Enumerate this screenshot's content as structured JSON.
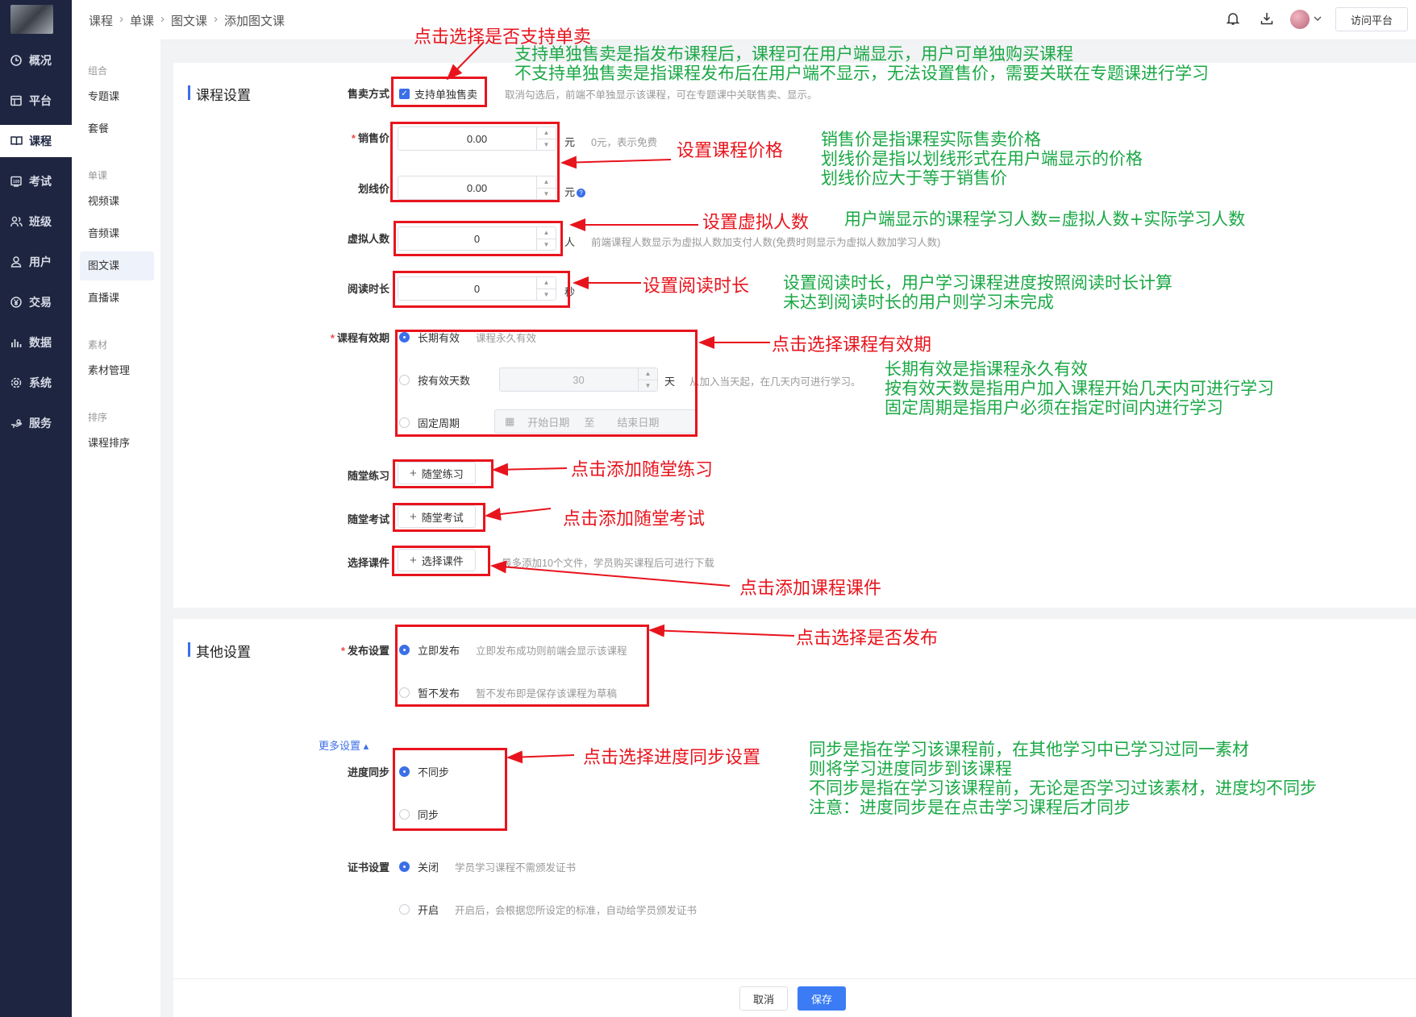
{
  "sidebar": {
    "items": [
      {
        "label": "概况",
        "icon": "clock-icon"
      },
      {
        "label": "平台",
        "icon": "browser-icon"
      },
      {
        "label": "课程",
        "icon": "book-icon"
      },
      {
        "label": "考试",
        "icon": "exam-icon"
      },
      {
        "label": "班级",
        "icon": "group-icon"
      },
      {
        "label": "用户",
        "icon": "user-icon"
      },
      {
        "label": "交易",
        "icon": "yuan-icon"
      },
      {
        "label": "数据",
        "icon": "bar-chart-icon"
      },
      {
        "label": "系统",
        "icon": "gear-icon"
      },
      {
        "label": "服务",
        "icon": "hand-icon"
      }
    ]
  },
  "submenu": {
    "groups": [
      "组合",
      "单课",
      "素材",
      "排序"
    ],
    "items": [
      "专题课",
      "套餐",
      "视频课",
      "音频课",
      "图文课",
      "直播课",
      "素材管理",
      "课程排序"
    ]
  },
  "topbar": {
    "breadcrumb": [
      "课程",
      "单课",
      "图文课",
      "添加图文课"
    ],
    "visit_label": "访问平台"
  },
  "course_settings": {
    "title": "课程设置",
    "sale_mode": {
      "label": "售卖方式",
      "checkbox": "支持单独售卖",
      "hint": "取消勾选后，前端不单独显示该课程，可在专题课中关联售卖、显示。"
    },
    "price": {
      "label": "销售价",
      "value": "0.00",
      "unit": "元",
      "hint": "0元，表示免费"
    },
    "strike_price": {
      "label": "划线价",
      "value": "0.00",
      "unit": "元"
    },
    "virtual_count": {
      "label": "虚拟人数",
      "value": "0",
      "unit": "人",
      "hint": "前端课程人数显示为虚拟人数加支付人数(免费时则显示为虚拟人数加学习人数)"
    },
    "read_time": {
      "label": "阅读时长",
      "value": "0",
      "unit": "秒"
    },
    "validity": {
      "label": "课程有效期",
      "options": [
        {
          "label": "长期有效",
          "hint": "课程永久有效",
          "selected": true
        },
        {
          "label": "按有效天数",
          "selected": false
        },
        {
          "label": "固定周期",
          "selected": false
        }
      ],
      "days_value": "30",
      "days_unit": "天",
      "days_hint": "从加入当天起，在几天内可进行学习。",
      "start_placeholder": "开始日期",
      "range_sep": "至",
      "end_placeholder": "结束日期"
    },
    "practice": {
      "label": "随堂练习",
      "button": "随堂练习"
    },
    "exam": {
      "label": "随堂考试",
      "button": "随堂考试"
    },
    "courseware": {
      "label": "选择课件",
      "button": "选择课件",
      "hint": "最多添加10个文件，学员购买课程后可进行下载"
    }
  },
  "other_settings": {
    "title": "其他设置",
    "publish": {
      "label": "发布设置",
      "options": [
        {
          "label": "立即发布",
          "hint": "立即发布成功则前端会显示该课程",
          "selected": true
        },
        {
          "label": "暂不发布",
          "hint": "暂不发布即是保存该课程为草稿",
          "selected": false
        }
      ]
    },
    "more_link": "更多设置 ▴",
    "sync": {
      "label": "进度同步",
      "options": [
        {
          "label": "不同步",
          "selected": true
        },
        {
          "label": "同步",
          "selected": false
        }
      ]
    },
    "certificate": {
      "label": "证书设置",
      "options": [
        {
          "label": "关闭",
          "hint": "学员学习课程不需颁发证书",
          "selected": true
        },
        {
          "label": "开启",
          "hint": "开启后，会根据您所设定的标准，自动给学员颁发证书",
          "selected": false
        }
      ]
    }
  },
  "footer": {
    "cancel": "取消",
    "save": "保存"
  },
  "annotations": {
    "sale_red": "点击选择是否支持单卖",
    "sale_green": [
      "支持单独售卖是指发布课程后，课程可在用户端显示，用户可单独购买课程",
      "不支持单独售卖是指课程发布后在用户端不显示，无法设置售价，需要关联在专题课进行学习"
    ],
    "price_red": "设置课程价格",
    "price_green": [
      "销售价是指课程实际售卖价格",
      "划线价是指以划线形式在用户端显示的价格",
      "划线价应大于等于销售价"
    ],
    "virtual_red": "设置虚拟人数",
    "virtual_green": "用户端显示的课程学习人数=虚拟人数+实际学习人数",
    "read_red": "设置阅读时长",
    "read_green": [
      "设置阅读时长，用户学习课程进度按照阅读时长计算",
      "未达到阅读时长的用户则学习未完成"
    ],
    "validity_red": "点击选择课程有效期",
    "validity_green": [
      "长期有效是指课程永久有效",
      "按有效天数是指用户加入课程开始几天内可进行学习",
      "固定周期是指用户必须在指定时间内进行学习"
    ],
    "practice_red": "点击添加随堂练习",
    "exam_red": "点击添加随堂考试",
    "courseware_red": "点击添加课程课件",
    "publish_red": "点击选择是否发布",
    "sync_red": "点击选择进度同步设置",
    "sync_green": [
      "同步是指在学习该课程前，在其他学习中已学习过同一素材",
      "则将学习进度同步到该课程",
      "不同步是指在学习该课程前，无论是否学习过该素材，进度均不同步",
      "注意：进度同步是在点击学习课程后才同步"
    ]
  },
  "colors": {
    "sidebar_bg": "#1d2540",
    "accent": "#3b6fe8",
    "annotation_red": "#e8141d",
    "annotation_green": "#1aa845"
  }
}
